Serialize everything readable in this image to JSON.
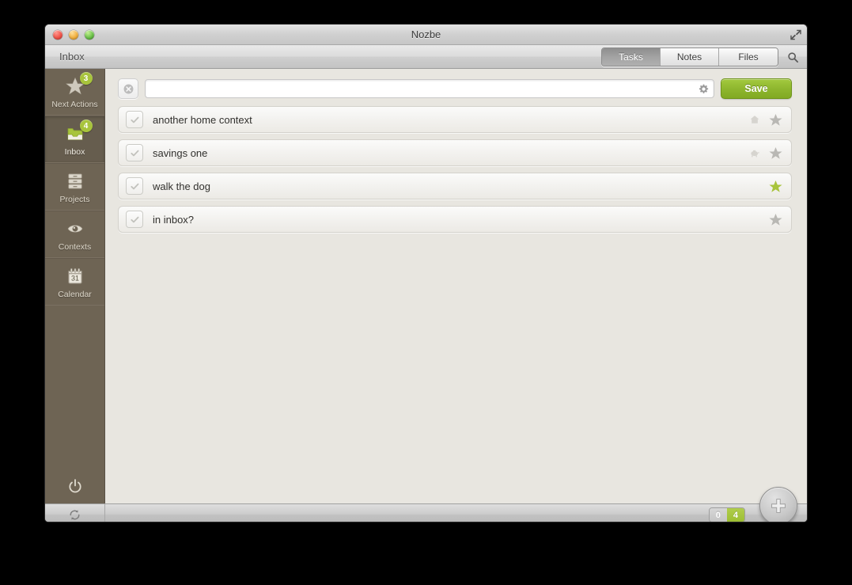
{
  "window": {
    "title": "Nozbe",
    "expand_icon": "fullscreen-expand-icon",
    "lights": [
      "close-red",
      "minimize-yellow",
      "zoom-green"
    ]
  },
  "toolbar": {
    "label": "Inbox",
    "search_icon": "search-icon",
    "segments": [
      {
        "label": "Tasks",
        "active": true
      },
      {
        "label": "Notes",
        "active": false
      },
      {
        "label": "Files",
        "active": false
      }
    ]
  },
  "sidebar": {
    "items": [
      {
        "label": "Next Actions",
        "icon": "star-icon",
        "badge": "3",
        "active": false
      },
      {
        "label": "Inbox",
        "icon": "inbox-tray-icon",
        "badge": "4",
        "active": true
      },
      {
        "label": "Projects",
        "icon": "drawers-icon",
        "badge": "",
        "active": false
      },
      {
        "label": "Contexts",
        "icon": "eye-icon",
        "badge": "",
        "active": false
      },
      {
        "label": "Calendar",
        "icon": "calendar-icon",
        "badge": "",
        "calendar_day": "31",
        "active": false
      }
    ],
    "power_icon": "power-icon"
  },
  "input_row": {
    "close_icon": "clear-x-icon",
    "value": "",
    "placeholder": "",
    "gear_icon": "gear-icon",
    "save_label": "Save"
  },
  "tasks": [
    {
      "title": "another home context",
      "checked": false,
      "context_icon": "home-icon",
      "starred": false
    },
    {
      "title": "savings one",
      "checked": false,
      "context_icon": "piggy-bank-icon",
      "starred": false
    },
    {
      "title": "walk the dog",
      "checked": false,
      "context_icon": "",
      "starred": true
    },
    {
      "title": "in inbox?",
      "checked": false,
      "context_icon": "",
      "starred": false
    }
  ],
  "statusbar": {
    "sync_icon": "sync-refresh-icon",
    "counter_left": "0",
    "counter_right": "4",
    "add_icon": "plus-icon"
  },
  "colors": {
    "sidebar": "#6e6454",
    "accent_green": "#a8c43c",
    "content_bg": "#e8e6e0",
    "save_green": "#8fb72f"
  }
}
